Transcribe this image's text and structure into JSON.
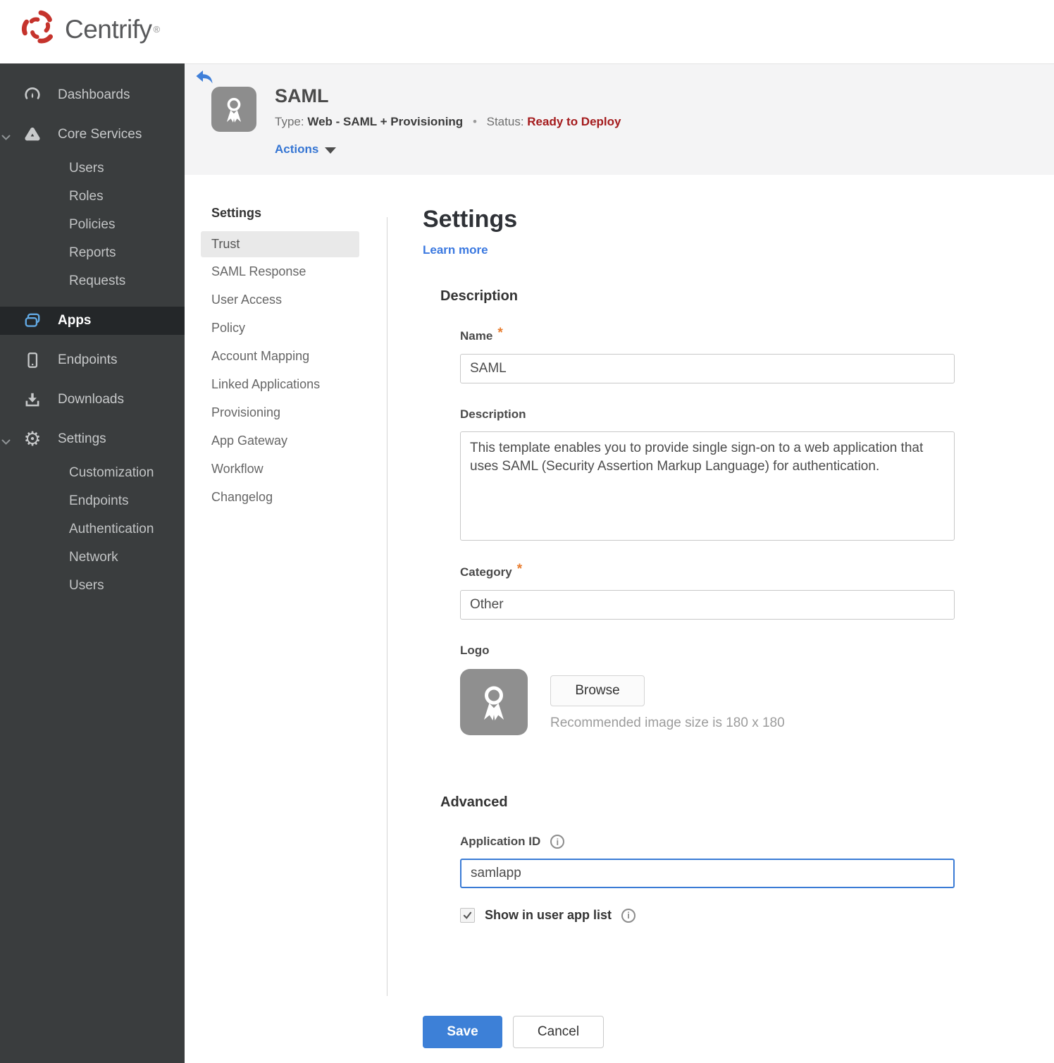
{
  "brand": {
    "name": "Centrify",
    "registered": "®"
  },
  "sidebar": {
    "dashboards": "Dashboards",
    "core_services": "Core Services",
    "core_children": [
      "Users",
      "Roles",
      "Policies",
      "Reports",
      "Requests"
    ],
    "apps": "Apps",
    "endpoints": "Endpoints",
    "downloads": "Downloads",
    "settings": "Settings",
    "settings_children": [
      "Customization",
      "Endpoints",
      "Authentication",
      "Network",
      "Users"
    ]
  },
  "app_header": {
    "title": "SAML",
    "type_label": "Type:",
    "type_value": "Web - SAML + Provisioning",
    "separator": "•",
    "status_label": "Status:",
    "status_value": "Ready to Deploy",
    "actions_label": "Actions"
  },
  "subnav": {
    "title": "Settings",
    "active": "Trust",
    "items": [
      "Trust",
      "SAML Response",
      "User Access",
      "Policy",
      "Account Mapping",
      "Linked Applications",
      "Provisioning",
      "App Gateway",
      "Workflow",
      "Changelog"
    ]
  },
  "form": {
    "title": "Settings",
    "learn_more": "Learn more",
    "description_section": "Description",
    "required_marker": "*",
    "name_label": "Name",
    "name_value": "SAML",
    "description_label": "Description",
    "description_value": "This template enables you to provide single sign-on to a web application that uses SAML (Security Assertion Markup Language) for authentication.",
    "category_label": "Category",
    "category_value": "Other",
    "logo_label": "Logo",
    "browse_label": "Browse",
    "logo_hint": "Recommended image size is 180 x 180",
    "advanced_section": "Advanced",
    "app_id_label": "Application ID",
    "app_id_value": "samlapp",
    "show_in_list_label": "Show in user app list",
    "save_label": "Save",
    "cancel_label": "Cancel"
  },
  "icons": {
    "info_glyph": "i",
    "gear_glyph": "⚙"
  },
  "colors": {
    "brand_red": "#c5332c",
    "accent_blue": "#3d80d7",
    "link_blue": "#3a78e0",
    "status_red": "#a41a1c",
    "sidebar_bg": "#3a3d3e",
    "sidebar_active_bg": "#242729",
    "header_bg": "#f4f4f5",
    "required_orange": "#e87c2e"
  }
}
